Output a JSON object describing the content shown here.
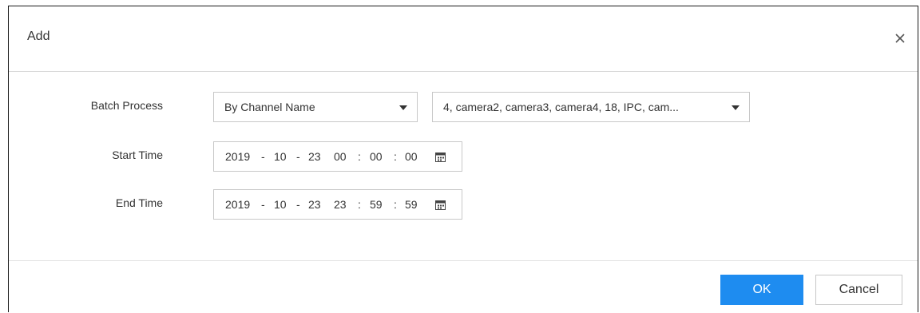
{
  "dialog": {
    "title": "Add",
    "close_icon": "close-icon"
  },
  "form": {
    "batch_process": {
      "label": "Batch Process",
      "mode_value": "By Channel Name",
      "channels_value": "4, camera2, camera3, camera4, 18, IPC, cam..."
    },
    "start_time": {
      "label": "Start Time",
      "year": "2019",
      "month": "10",
      "day": "23",
      "hour": "00",
      "minute": "00",
      "second": "00",
      "date_sep": "-",
      "time_sep": ":",
      "calendar_icon": "calendar-icon"
    },
    "end_time": {
      "label": "End Time",
      "year": "2019",
      "month": "10",
      "day": "23",
      "hour": "23",
      "minute": "59",
      "second": "59",
      "date_sep": "-",
      "time_sep": ":",
      "calendar_icon": "calendar-icon"
    }
  },
  "footer": {
    "ok_label": "OK",
    "cancel_label": "Cancel"
  },
  "colors": {
    "primary": "#1e8cf0",
    "border": "#c8c8c8",
    "text": "#333333"
  }
}
